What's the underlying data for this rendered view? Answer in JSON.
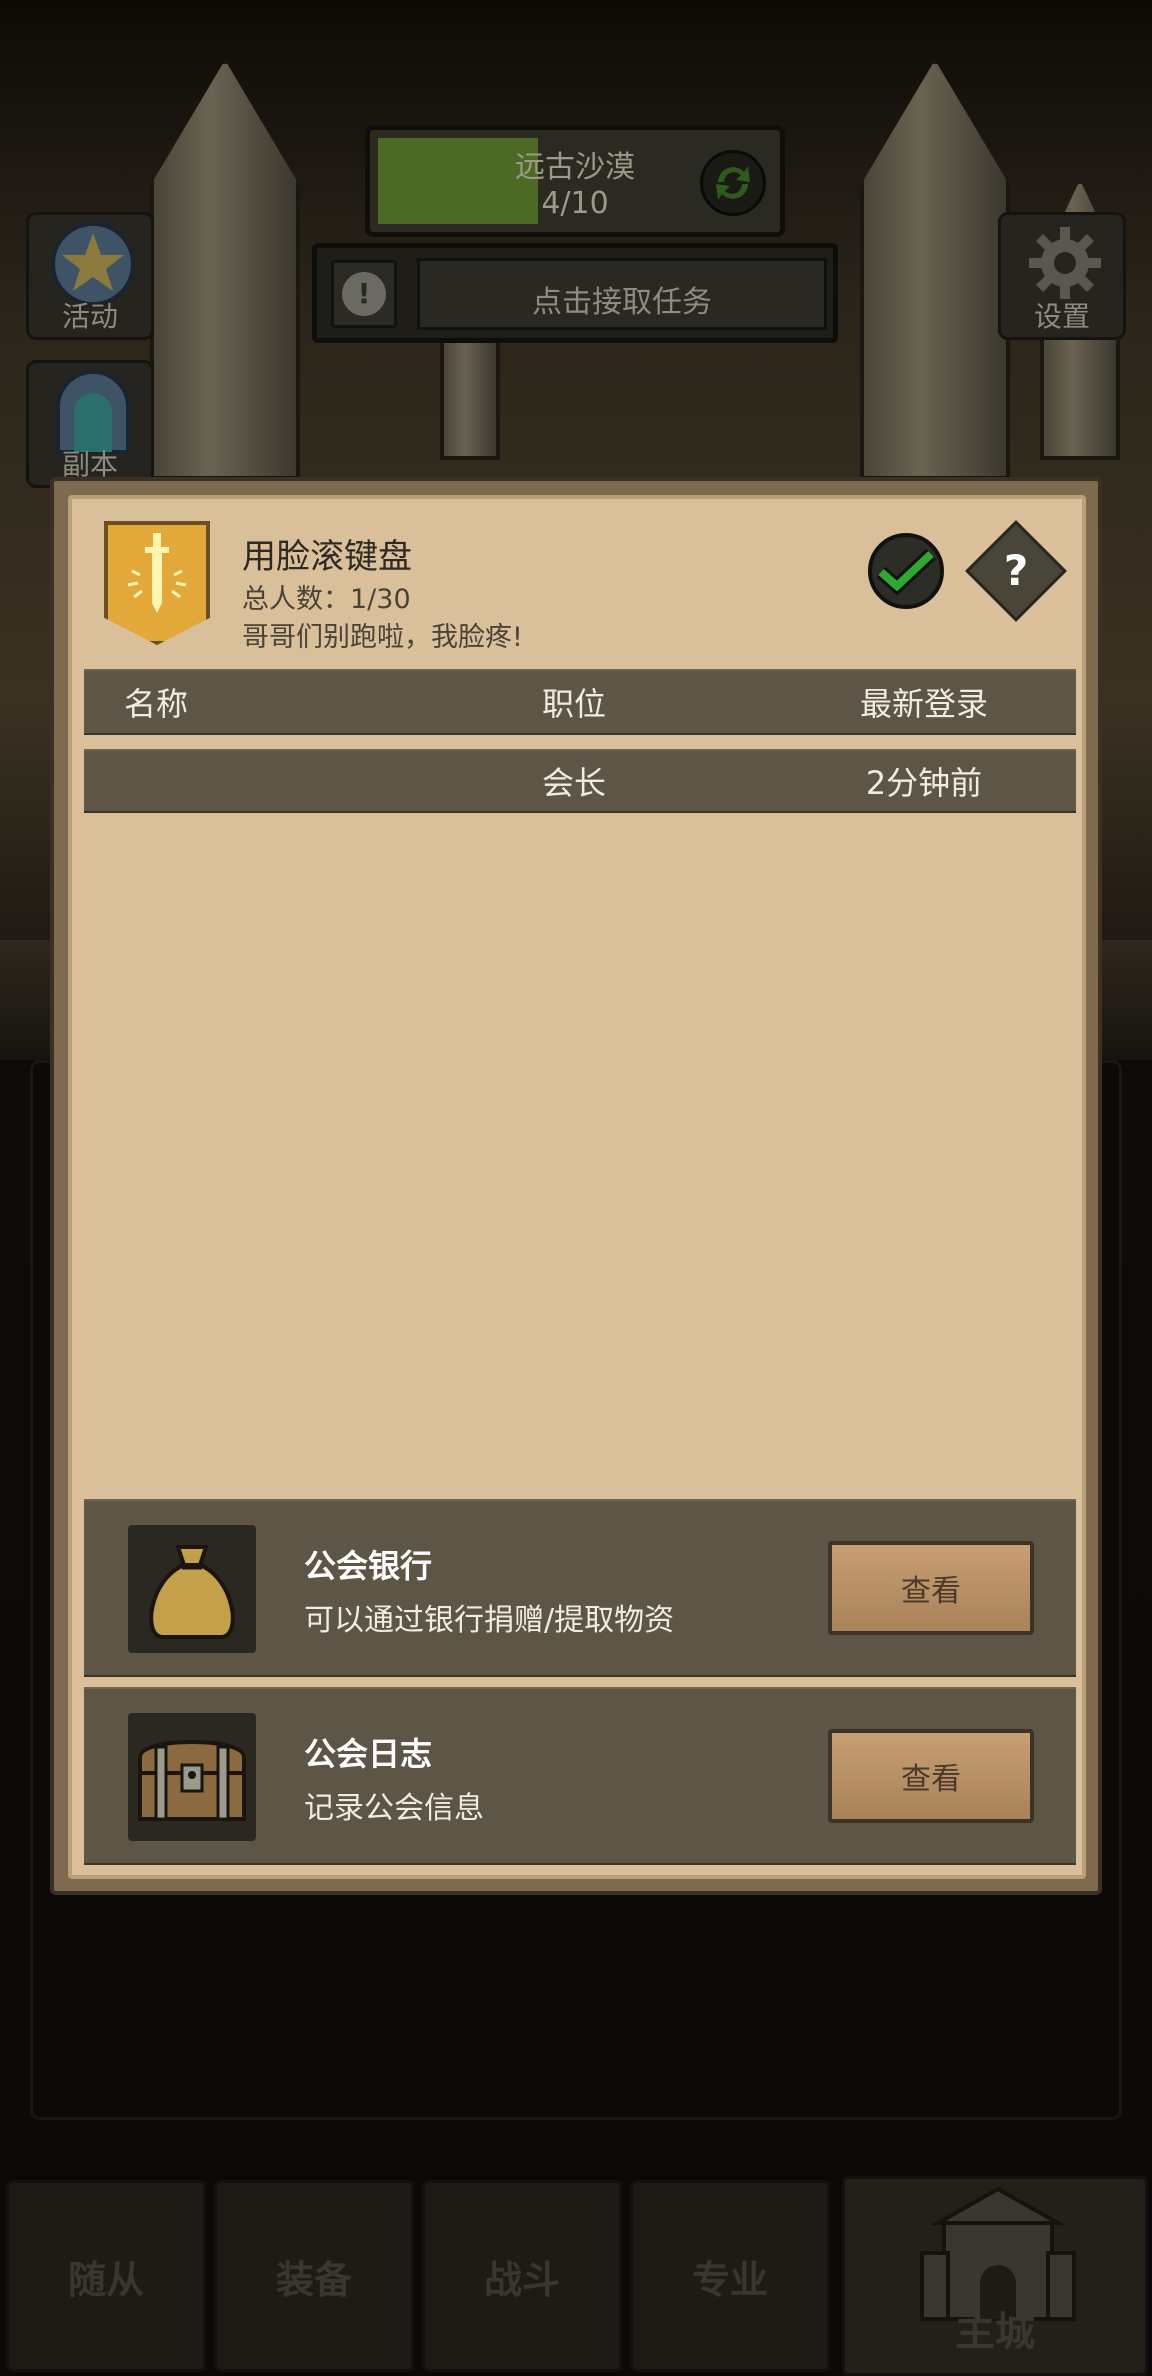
{
  "hud": {
    "zone_name": "远古沙漠",
    "zone_progress": "4/10",
    "zone_progress_fraction": 0.4,
    "task_label": "点击接取任务",
    "left_buttons": [
      {
        "label": "活动",
        "icon": "star-icon"
      },
      {
        "label": "副本",
        "icon": "portal-icon"
      }
    ],
    "settings_label": "设置"
  },
  "guild": {
    "name": "用脸滚键盘",
    "member_count": "总人数：1/30",
    "motto": "哥哥们别跑啦，我脸疼!",
    "badge_icon": "sword-emblem-icon",
    "help_symbol": "?"
  },
  "members_table": {
    "headers": {
      "name": "名称",
      "role": "职位",
      "last_login": "最新登录"
    },
    "rows": [
      {
        "name": "",
        "role": "会长",
        "last_login": "2分钟前"
      }
    ]
  },
  "features": [
    {
      "title": "公会银行",
      "desc": "可以通过银行捐赠/提取物资",
      "button": "查看",
      "icon": "money-bag-icon"
    },
    {
      "title": "公会日志",
      "desc": "记录公会信息",
      "button": "查看",
      "icon": "treasure-chest-icon"
    }
  ],
  "bottom_nav": {
    "tabs": [
      "随从",
      "装备",
      "战斗",
      "专业"
    ],
    "main_tab": "主城"
  },
  "colors": {
    "parchment": "#d9c09a",
    "row_bar": "#5d5545",
    "progress_green": "#4d6a24",
    "badge_gold": "#e2a93a",
    "check_green": "#2fa82f"
  }
}
